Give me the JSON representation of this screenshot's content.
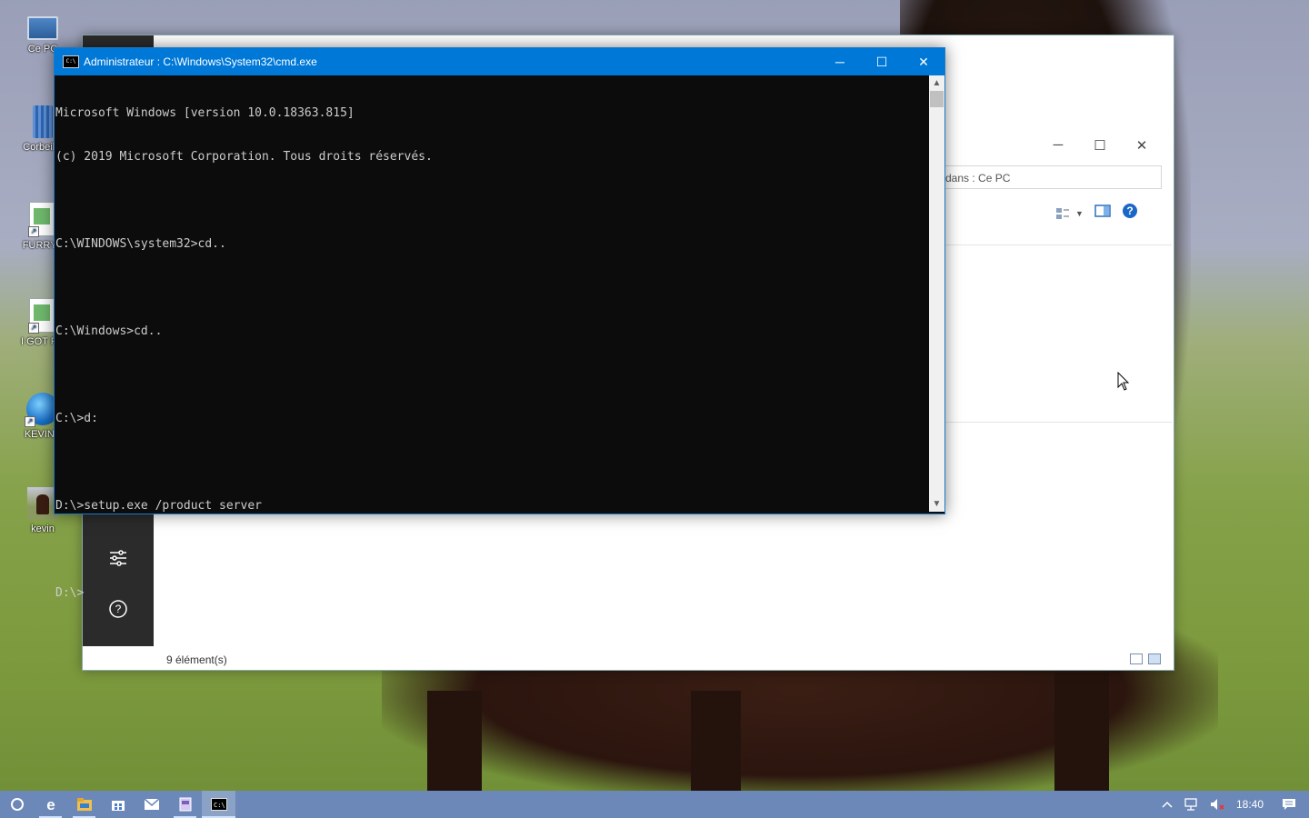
{
  "desktop": {
    "icons": [
      {
        "label": "Ce PC"
      },
      {
        "label": "Corbeille"
      },
      {
        "label": "FURRYF"
      },
      {
        "label": "I GOT RA"
      },
      {
        "label": "KEVINA"
      },
      {
        "label": "kevin"
      }
    ]
  },
  "explorer": {
    "search_placeholder": "dans : Ce PC",
    "status_text": "9 élément(s)",
    "controls": {
      "minimize": "─",
      "maximize": "☐",
      "close": "✕"
    }
  },
  "cmd": {
    "title": "Administrateur : C:\\Windows\\System32\\cmd.exe",
    "icon_text": "C:\\",
    "controls": {
      "minimize": "─",
      "maximize": "☐",
      "close": "✕"
    },
    "lines": [
      "Microsoft Windows [version 10.0.18363.815]",
      "(c) 2019 Microsoft Corporation. Tous droits réservés.",
      "",
      "C:\\WINDOWS\\system32>cd..",
      "",
      "C:\\Windows>cd..",
      "",
      "C:\\>d:",
      "",
      "D:\\>setup.exe /product server",
      "",
      "D:\\>"
    ]
  },
  "taskbar": {
    "clock": "18:40",
    "items": [
      "cortana-icon",
      "edge-icon",
      "file-explorer-icon",
      "store-icon",
      "mail-icon",
      "app-icon",
      "cmd-icon"
    ]
  },
  "colors": {
    "title_bar": "#0078d7",
    "console_bg": "#0c0c0c",
    "console_text": "#cccccc",
    "taskbar": "#6b88b8"
  }
}
